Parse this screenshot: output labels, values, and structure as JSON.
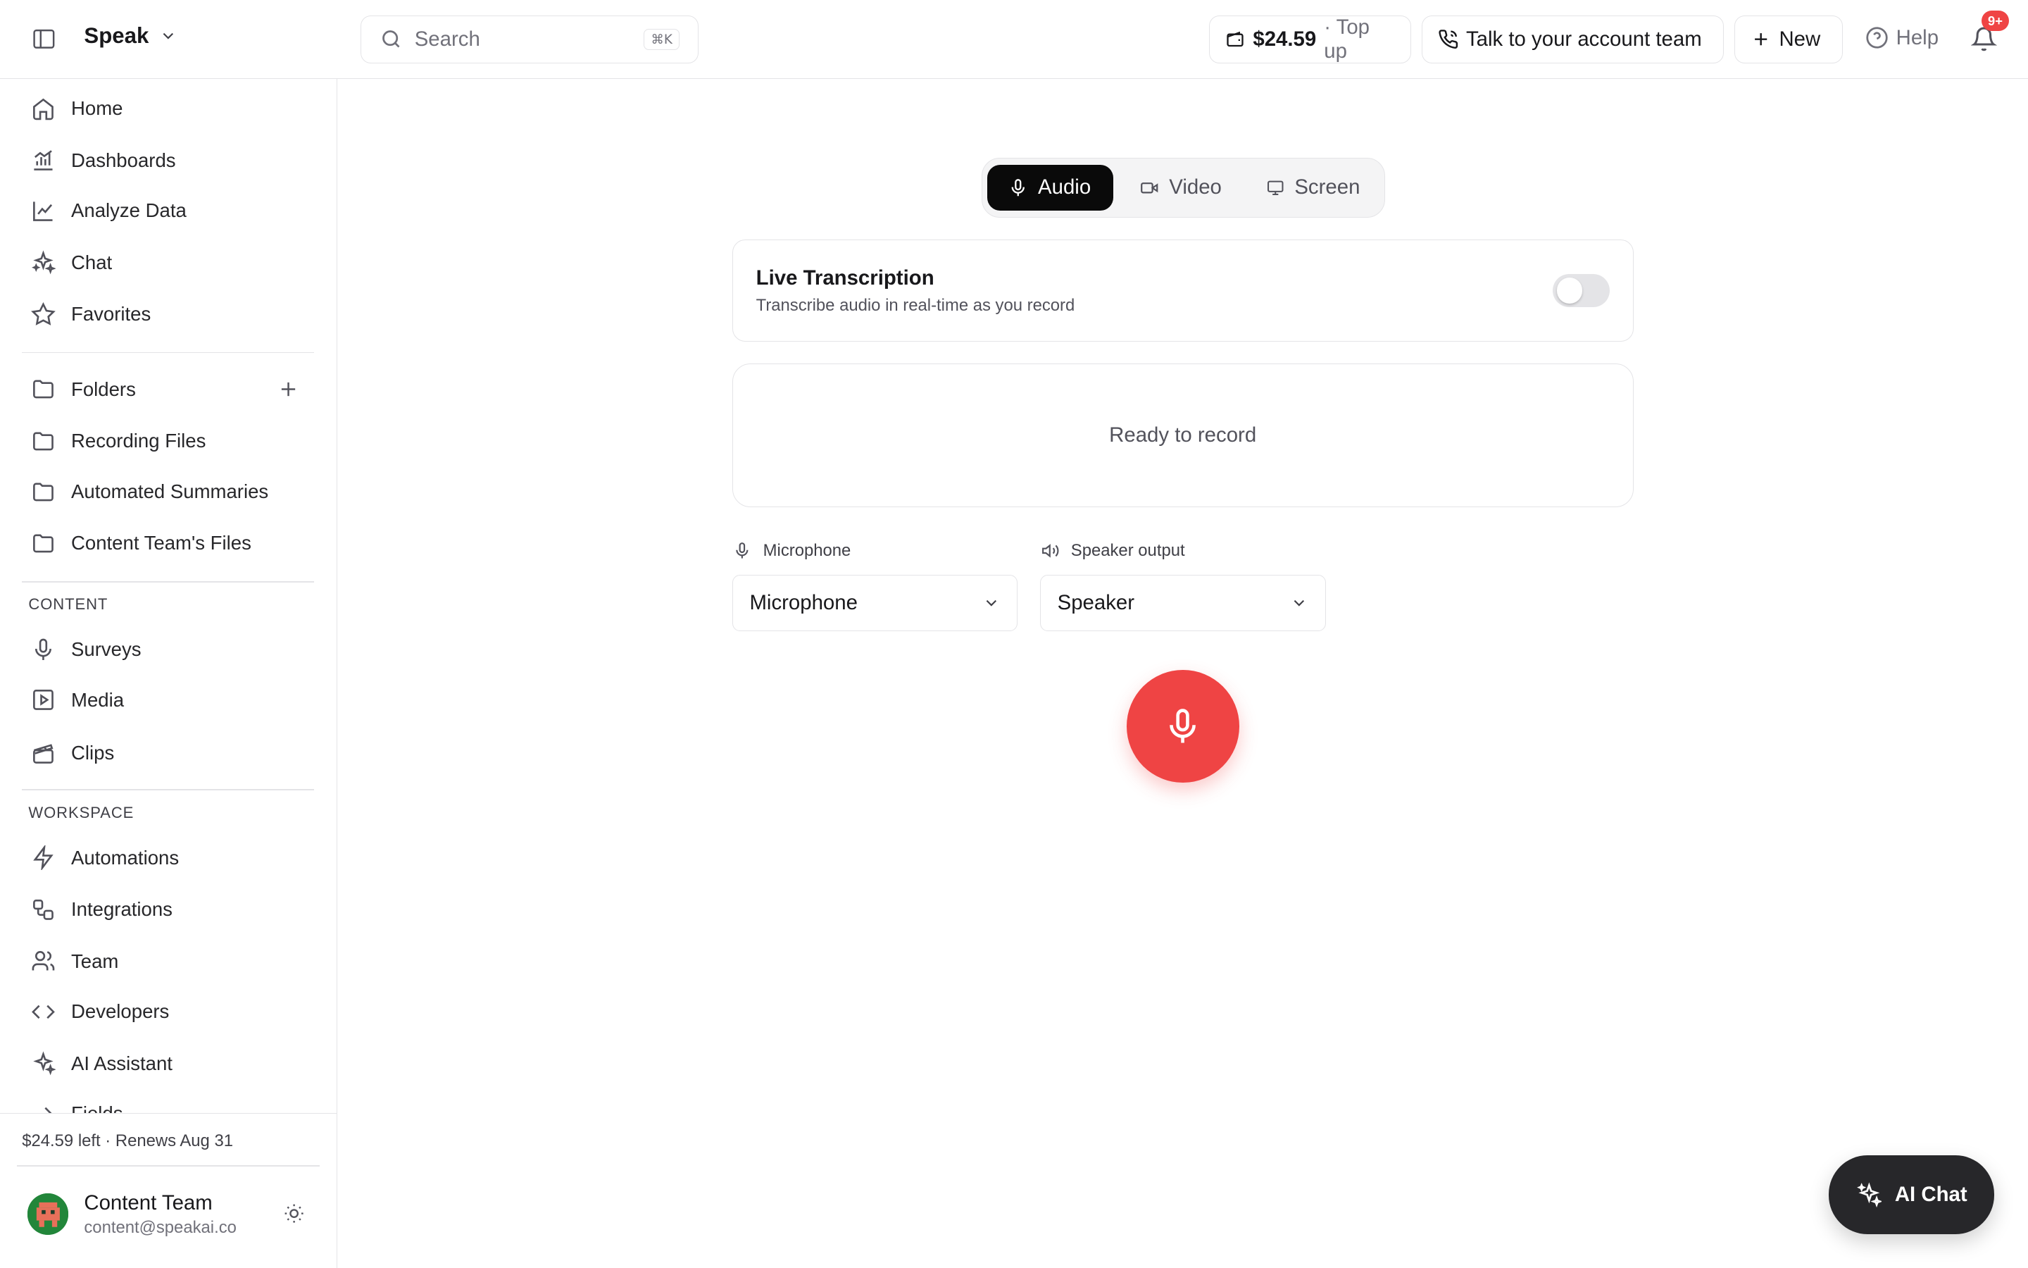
{
  "app": {
    "name": "Speak"
  },
  "search": {
    "placeholder": "Search",
    "shortcut": "⌘K"
  },
  "topbar": {
    "balance": "$24.59",
    "topup": "· Top up",
    "account_team": "Talk to your account team",
    "new": "New",
    "help": "Help",
    "notification_badge": "9+"
  },
  "sidebar": {
    "primary": [
      {
        "label": "Home",
        "icon": "home-icon"
      },
      {
        "label": "Dashboards",
        "icon": "bar-chart-icon"
      },
      {
        "label": "Analyze Data",
        "icon": "line-chart-icon"
      },
      {
        "label": "Chat",
        "icon": "sparkles-icon"
      },
      {
        "label": "Favorites",
        "icon": "star-icon"
      }
    ],
    "folders_label": "Folders",
    "folders": [
      {
        "label": "Recording Files"
      },
      {
        "label": "Automated Summaries"
      },
      {
        "label": "Content Team's Files"
      }
    ],
    "content_section": "CONTENT",
    "content": [
      {
        "label": "Surveys",
        "icon": "mic-icon"
      },
      {
        "label": "Media",
        "icon": "play-square-icon"
      },
      {
        "label": "Clips",
        "icon": "clapperboard-icon"
      }
    ],
    "workspace_section": "WORKSPACE",
    "workspace": [
      {
        "label": "Automations",
        "icon": "zap-icon"
      },
      {
        "label": "Integrations",
        "icon": "workflow-icon"
      },
      {
        "label": "Team",
        "icon": "users-icon"
      },
      {
        "label": "Developers",
        "icon": "code-icon"
      },
      {
        "label": "AI Assistant",
        "icon": "sparkles-icon"
      },
      {
        "label": "Fields",
        "icon": "arrow-right-icon"
      }
    ],
    "footer": {
      "renewal": "$24.59 left · Renews Aug 31",
      "user_name": "Content Team",
      "user_email": "content@speakai.co"
    }
  },
  "recorder": {
    "modes": [
      "Audio",
      "Video",
      "Screen"
    ],
    "active_mode": "Audio",
    "live_title": "Live Transcription",
    "live_subtitle": "Transcribe audio in real-time as you record",
    "live_enabled": false,
    "status": "Ready to record",
    "mic_label": "Microphone",
    "mic_value": "Microphone",
    "speaker_label": "Speaker output",
    "speaker_value": "Speaker"
  },
  "ai_chat": {
    "label": "AI Chat"
  },
  "colors": {
    "record": "#ef4444",
    "active_tab": "#0a0a0a",
    "ai_chat_bg": "#27272a"
  }
}
